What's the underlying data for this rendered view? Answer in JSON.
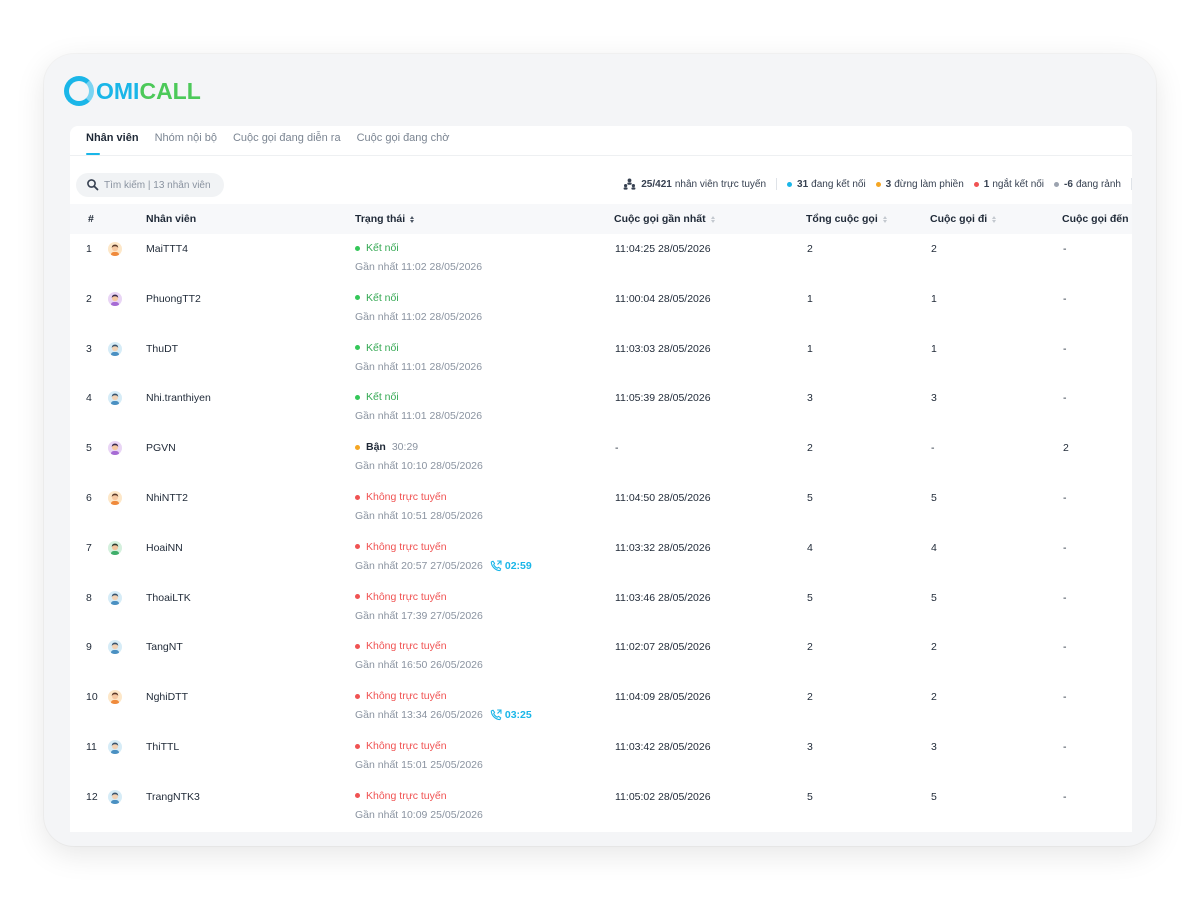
{
  "brand": {
    "logo_omi": "OMI",
    "logo_call": "CALL"
  },
  "tabs": [
    {
      "label": "Nhân viên",
      "active": true
    },
    {
      "label": "Nhóm nội bộ",
      "active": false
    },
    {
      "label": "Cuộc gọi đang diễn ra",
      "active": false
    },
    {
      "label": "Cuộc gọi đang chờ",
      "active": false
    }
  ],
  "search": {
    "placeholder": "Tìm kiếm | 13 nhân viên",
    "icon": "search-icon"
  },
  "stats": {
    "online_count": "25/421",
    "online_label": "nhân viên trực tuyến",
    "connected_count": "31",
    "connected_label": "đang kết nối",
    "dnd_count": "3",
    "dnd_label": "đừng làm phiền",
    "disconnected_count": "1",
    "disconnected_label": "ngắt kết nối",
    "idle_count": "-6",
    "idle_label": "đang rảnh"
  },
  "colors": {
    "connected": "#1ab6e8",
    "dnd": "#f5a623",
    "disconnected": "#f05252",
    "idle": "#9ca3af",
    "status_online": "#34c759",
    "status_busy": "#f5a623",
    "status_offline": "#f05252",
    "accent": "#1ab6e8"
  },
  "columns": {
    "index": "#",
    "employee": "Nhân viên",
    "status": "Trạng thái",
    "last_call": "Cuộc gọi gần nhất",
    "total_calls": "Tổng cuộc gọi",
    "outgoing": "Cuộc gọi đi",
    "incoming": "Cuộc gọi đến"
  },
  "rows": [
    {
      "index": "1",
      "name": "MaiTTT4",
      "avatar": "female-avatar",
      "status": "Kết nối",
      "status_type": "online",
      "last_seen": "Gần nhất 11:02 28/05/2026",
      "call_timer": "",
      "last_call": "11:04:25 28/05/2026",
      "total": "2",
      "outgoing": "2",
      "incoming": "-"
    },
    {
      "index": "2",
      "name": "PhuongTT2",
      "avatar": "female-avatar-2",
      "status": "Kết nối",
      "status_type": "online",
      "last_seen": "Gần nhất 11:02 28/05/2026",
      "call_timer": "",
      "last_call": "11:00:04 28/05/2026",
      "total": "1",
      "outgoing": "1",
      "incoming": "-"
    },
    {
      "index": "3",
      "name": "ThuDT",
      "avatar": "default-avatar",
      "status": "Kết nối",
      "status_type": "online",
      "last_seen": "Gần nhất 11:01 28/05/2026",
      "call_timer": "",
      "last_call": "11:03:03 28/05/2026",
      "total": "1",
      "outgoing": "1",
      "incoming": "-"
    },
    {
      "index": "4",
      "name": "Nhi.tranthiyen",
      "avatar": "default-avatar",
      "status": "Kết nối",
      "status_type": "online",
      "last_seen": "Gần nhất 11:01 28/05/2026",
      "call_timer": "",
      "last_call": "11:05:39 28/05/2026",
      "total": "3",
      "outgoing": "3",
      "incoming": "-"
    },
    {
      "index": "5",
      "name": "PGVN",
      "avatar": "female-avatar-2",
      "status": "Bận",
      "status_type": "busy",
      "busy_time": "30:29",
      "last_seen": "Gần nhất 10:10 28/05/2026",
      "call_timer": "",
      "last_call": "-",
      "total": "2",
      "outgoing": "-",
      "incoming": "2"
    },
    {
      "index": "6",
      "name": "NhiNTT2",
      "avatar": "female-avatar",
      "status": "Không trực tuyến",
      "status_type": "offline",
      "last_seen": "Gần nhất 10:51 28/05/2026",
      "call_timer": "",
      "last_call": "11:04:50 28/05/2026",
      "total": "5",
      "outgoing": "5",
      "incoming": "-"
    },
    {
      "index": "7",
      "name": "HoaiNN",
      "avatar": "male-avatar",
      "status": "Không trực tuyến",
      "status_type": "offline",
      "last_seen": "Gần nhất 20:57 27/05/2026",
      "call_timer": "02:59",
      "last_call": "11:03:32 28/05/2026",
      "total": "4",
      "outgoing": "4",
      "incoming": "-"
    },
    {
      "index": "8",
      "name": "ThoaiLTK",
      "avatar": "default-avatar",
      "status": "Không trực tuyến",
      "status_type": "offline",
      "last_seen": "Gần nhất 17:39 27/05/2026",
      "call_timer": "",
      "last_call": "11:03:46 28/05/2026",
      "total": "5",
      "outgoing": "5",
      "incoming": "-"
    },
    {
      "index": "9",
      "name": "TangNT",
      "avatar": "default-avatar",
      "status": "Không trực tuyến",
      "status_type": "offline",
      "last_seen": "Gần nhất 16:50 26/05/2026",
      "call_timer": "",
      "last_call": "11:02:07 28/05/2026",
      "total": "2",
      "outgoing": "2",
      "incoming": "-"
    },
    {
      "index": "10",
      "name": "NghiDTT",
      "avatar": "female-avatar",
      "status": "Không trực tuyến",
      "status_type": "offline",
      "last_seen": "Gần nhất 13:34 26/05/2026",
      "call_timer": "03:25",
      "last_call": "11:04:09 28/05/2026",
      "total": "2",
      "outgoing": "2",
      "incoming": "-"
    },
    {
      "index": "11",
      "name": "ThiTTL",
      "avatar": "default-avatar",
      "status": "Không trực tuyến",
      "status_type": "offline",
      "last_seen": "Gần nhất 15:01 25/05/2026",
      "call_timer": "",
      "last_call": "11:03:42 28/05/2026",
      "total": "3",
      "outgoing": "3",
      "incoming": "-"
    },
    {
      "index": "12",
      "name": "TrangNTK3",
      "avatar": "default-avatar",
      "status": "Không trực tuyến",
      "status_type": "offline",
      "last_seen": "Gần nhất 10:09 25/05/2026",
      "call_timer": "",
      "last_call": "11:05:02 28/05/2026",
      "total": "5",
      "outgoing": "5",
      "incoming": "-"
    }
  ]
}
